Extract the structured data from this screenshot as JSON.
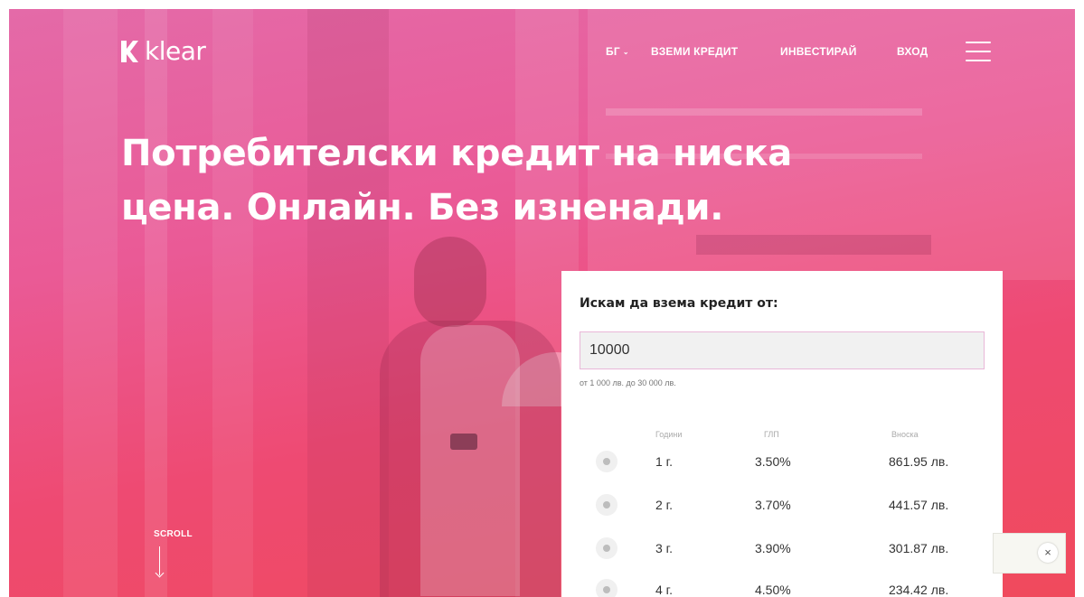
{
  "header": {
    "logo_text": "klear",
    "nav": {
      "lang": "БГ",
      "take_credit": "ВЗЕМИ КРЕДИТ",
      "invest": "ИНВЕСТИРАЙ",
      "login": "ВХОД"
    }
  },
  "hero": {
    "title_line1": "Потребителски кредит на ниска",
    "title_line2": "цена. Онлайн. Без изненади."
  },
  "scroll": {
    "label": "SCROLL"
  },
  "loan_card": {
    "title": "Искам да взема кредит от:",
    "amount_value": "10000",
    "range_note": "от 1 000 лв. до 30 000 лв.",
    "columns": {
      "years": "Години",
      "apr": "ГЛП",
      "installment": "Вноска"
    },
    "rows": [
      {
        "years": "1 г.",
        "apr": "3.50%",
        "installment": "861.95 лв."
      },
      {
        "years": "2 г.",
        "apr": "3.70%",
        "installment": "441.57 лв."
      },
      {
        "years": "3 г.",
        "apr": "3.90%",
        "installment": "301.87 лв."
      },
      {
        "years": "4 г.",
        "apr": "4.50%",
        "installment": "234.42 лв."
      }
    ]
  },
  "toast": {
    "close_symbol": "×"
  },
  "icons": {
    "logo": "klear-k-logo-icon",
    "lang_chevron": "chevron-down-icon",
    "menu": "hamburger-menu-icon",
    "scroll": "arrow-down-icon",
    "row_selector": "radio-icon",
    "close": "close-icon"
  },
  "colors": {
    "hero_gradient_top": "#e46aa8",
    "hero_gradient_bottom": "#f04a5c",
    "input_border": "#e9b7d8",
    "card_bg": "#ffffff"
  }
}
